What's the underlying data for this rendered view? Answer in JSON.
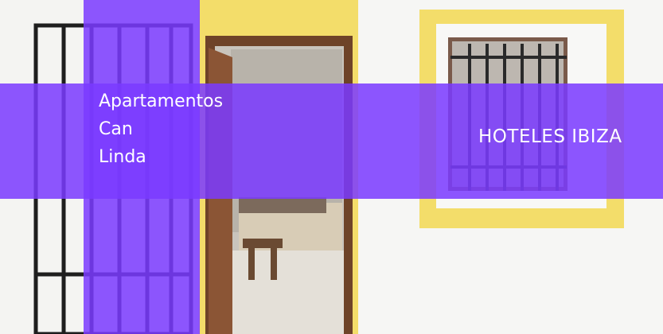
{
  "hero": {
    "title_lines": [
      "Apartamentos",
      "Can",
      "Linda"
    ],
    "category": "HOTELES IBIZA"
  },
  "colors": {
    "overlay": "#7a3aff",
    "wall": "#f4f4f2",
    "yellow_trim": "#f3dd6a",
    "door_wood": "#7a4a2c",
    "iron_bars": "#1e1e1e"
  }
}
